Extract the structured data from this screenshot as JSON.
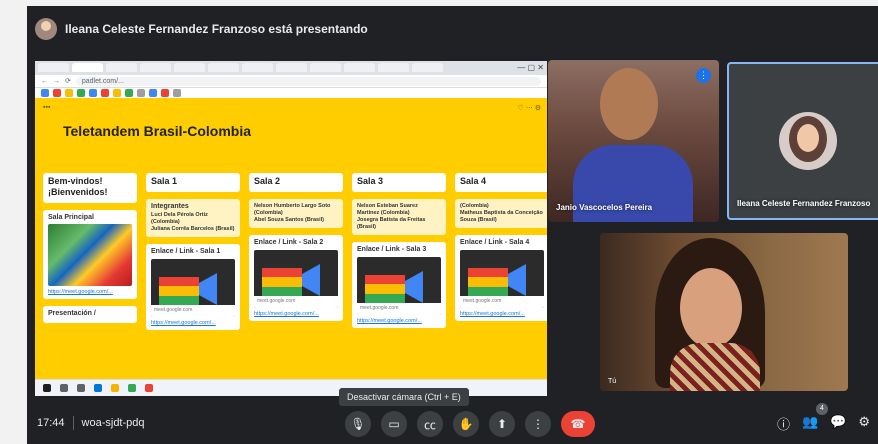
{
  "presenter_banner": "Ileana Celeste Fernandez Franzoso está presentando",
  "browser": {
    "url": "padlet.com/..."
  },
  "padlet": {
    "title": "Teletandem Brasil-Colombia",
    "columns": [
      {
        "header": "Bem-vindos!\n¡Bienvenidos!",
        "cards": [
          {
            "title": "Sala Principal"
          },
          {
            "title": "Presentación /"
          }
        ]
      },
      {
        "header": "Sala 1",
        "integrantes_title": "Integrantes",
        "names": "Luci Dela Pérola Ortiz (Colombia)\nJuliana Corrêa Barcelos (Brasil)",
        "link_title": "Enlace / Link - Sala 1"
      },
      {
        "header": "Sala 2",
        "names": "Nelson Humberto Largo Soto (Colombia)\nAbel Souza Santos (Brasil)",
        "link_title": "Enlace / Link - Sala 2"
      },
      {
        "header": "Sala 3",
        "names": "Nelson Esteban Suarez Martinez (Colombia)\nJosegra Batista da Freitas (Brasil)",
        "link_title": "Enlace / Link - Sala 3"
      },
      {
        "header": "Sala 4",
        "names": "(Colombia)\nMatheus Baptista da Conceição Souza (Brasil)",
        "link_title": "Enlace / Link - Sala 4"
      }
    ],
    "link_domain": "meet.google.com",
    "link_url": "https://meet.google.com/..."
  },
  "participants": [
    {
      "name": "Janio Vascocelos Pereira"
    },
    {
      "name": "Ileana Celeste Fernandez Franzoso"
    },
    {
      "name": "Tú"
    }
  ],
  "tooltip": "Desactivar cámara (Ctrl + E)",
  "meeting": {
    "time": "17:44",
    "code": "woa-sjdt-pdq",
    "participant_count": "4"
  },
  "colors": {
    "padlet_yellow": "#ffcd00",
    "end_call": "#ea4335",
    "mic_active": "#1a73e8"
  }
}
